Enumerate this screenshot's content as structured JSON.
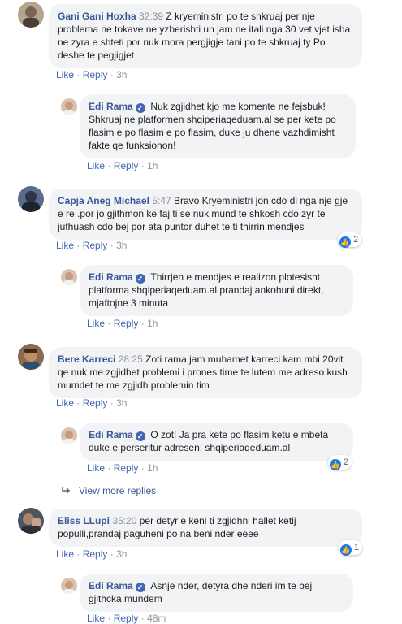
{
  "labels": {
    "like": "Like",
    "reply": "Reply",
    "dot": "·",
    "verified_mark": "✓"
  },
  "colors": {
    "link": "#385898",
    "bubble": "#f2f3f5",
    "meta": "#90949c",
    "like_blue": "#1877f2"
  },
  "comments": [
    {
      "author": "Gani Gani Hoxha",
      "time": "32:39",
      "text": "Z kryeministri po te shkruaj per nje problema ne tokave ne yzberishti un jam ne itali nga 30 vet vjet isha ne zyra e shteti por nuk mora pergjigje tani po te shkruaj ty Po deshe te pegjigjet",
      "ago": "3h",
      "reply": {
        "author": "Edi Rama",
        "text": "Nuk zgjidhet kjo me komente ne fejsbuk! Shkruaj ne platformen shqiperiaqeduam.al se per kete po flasim e po flasim e po flasim, duke ju dhene vazhdimisht fakte qe funksionon!",
        "ago": "1h"
      }
    },
    {
      "author": "Capja Aneg Michael",
      "time": "5:47",
      "text": "Bravo Kryeministri jon cdo di nga nje gje e re .por jo gjithmon ke faj ti se nuk mund te shkosh cdo zyr te juthuash cdo bej por ata puntor duhet te ti thirrin mendjes",
      "ago": "3h",
      "reactions": "2",
      "reply": {
        "author": "Edi Rama",
        "text": "Thirrjen e mendjes e realizon plotesisht platforma shqiperiaqeduam.al prandaj ankohuni direkt, mjaftojne 3 minuta",
        "ago": "1h"
      }
    },
    {
      "author": "Bere Karreci",
      "time": "28:25",
      "text": "Zoti rama jam muhamet karreci kam mbi 20vit qe nuk me zgjidhet problemi i prones time te lutem me adreso kush mumdet te me zgjidh problemin tim",
      "ago": "3h",
      "reply": {
        "author": "Edi Rama",
        "text": "O zot! Ja pra kete po flasim ketu e mbeta duke e perseritur adresen: shqiperiaqeduam.al",
        "ago": "1h",
        "reactions": "2"
      },
      "view_more": "View more replies"
    },
    {
      "author": "Eliss LLupi",
      "time": "35:20",
      "text": "per detyr e keni ti zgjidhni hallet ketij populli,prandaj paguheni po na beni nder eeee",
      "ago": "3h",
      "reactions": "1",
      "reply": {
        "author": "Edi Rama",
        "text": "Asnje nder, detyra dhe nderi im te bej gjithcka mundem",
        "ago": "48m"
      }
    }
  ]
}
